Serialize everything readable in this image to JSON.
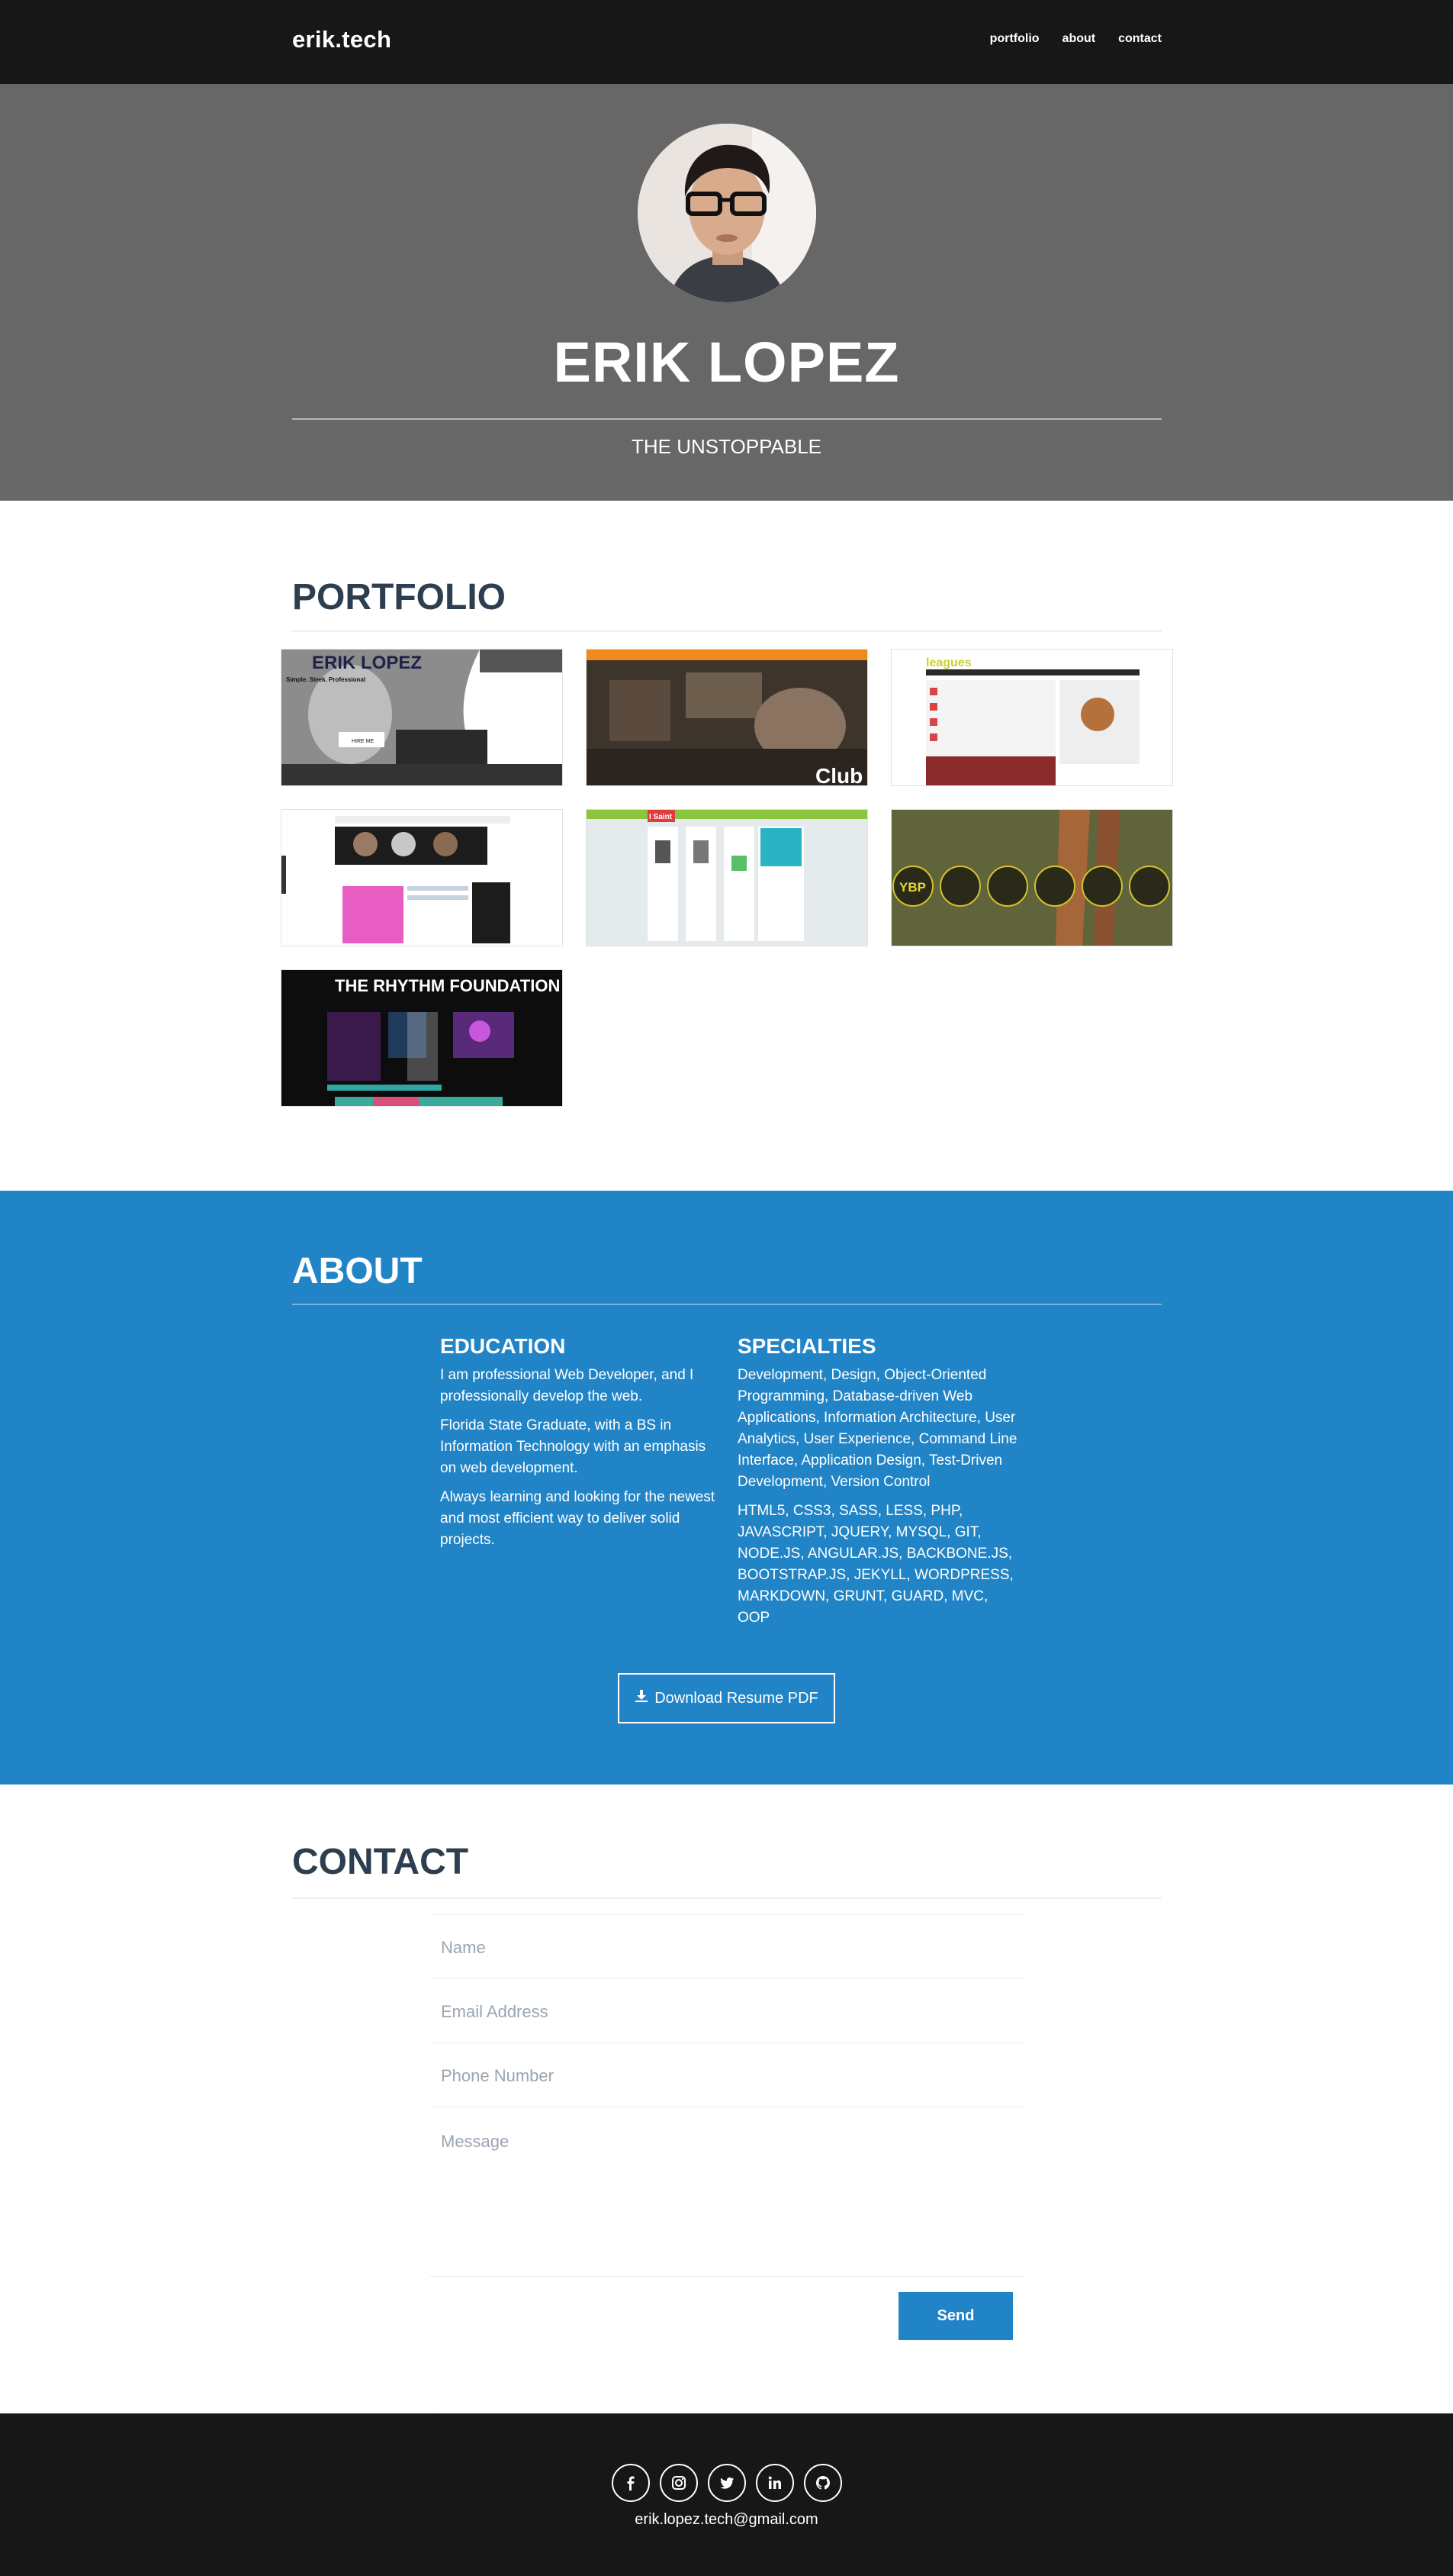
{
  "nav": {
    "brand": "erik.tech",
    "links": [
      "portfolio",
      "about",
      "contact"
    ]
  },
  "hero": {
    "name": "ERIK LOPEZ",
    "tagline": "THE UNSTOPPABLE"
  },
  "portfolio": {
    "title": "PORTFOLIO",
    "thumbs": [
      {
        "text": "ERIK LOPEZ",
        "caption": "Simple. Sleek. Professional",
        "button": "HIRE ME"
      },
      {
        "text": "Club"
      },
      {
        "text": "leagues"
      },
      {
        "text": ""
      },
      {
        "text": "I Saint"
      },
      {
        "text": "YBP"
      },
      {
        "text": "THE RHYTHM FOUNDATION"
      }
    ]
  },
  "about": {
    "title": "ABOUT",
    "education": {
      "heading": "EDUCATION",
      "p1": "I am professional Web Developer, and I professionally develop the web.",
      "p2": "Florida State Graduate, with a BS in Information Technology with an emphasis on web development.",
      "p3": "Always learning and looking for the newest and most efficient way to deliver solid projects."
    },
    "specialties": {
      "heading": "SPECIALTIES",
      "p1": "Development, Design, Object-Oriented Programming, Database-driven Web Applications, Information Architecture, User Analytics, User Experience, Command Line Interface, Application Design, Test-Driven Development, Version Control",
      "p2": "HTML5, CSS3, SASS, LESS, PHP, JAVASCRIPT, JQUERY, MYSQL, GIT, NODE.JS, ANGULAR.JS, BACKBONE.JS, BOOTSTRAP.JS, JEKYLL, WORDPRESS, MARKDOWN, GRUNT, GUARD, MVC, OOP"
    },
    "resume_label": "Download Resume PDF"
  },
  "contact": {
    "title": "CONTACT",
    "name_placeholder": "Name",
    "email_placeholder": "Email Address",
    "phone_placeholder": "Phone Number",
    "message_placeholder": "Message",
    "send_label": "Send"
  },
  "footer": {
    "icons": [
      "facebook-icon",
      "instagram-icon",
      "twitter-icon",
      "linkedin-icon",
      "github-icon"
    ],
    "email": "erik.lopez.tech@gmail.com"
  }
}
